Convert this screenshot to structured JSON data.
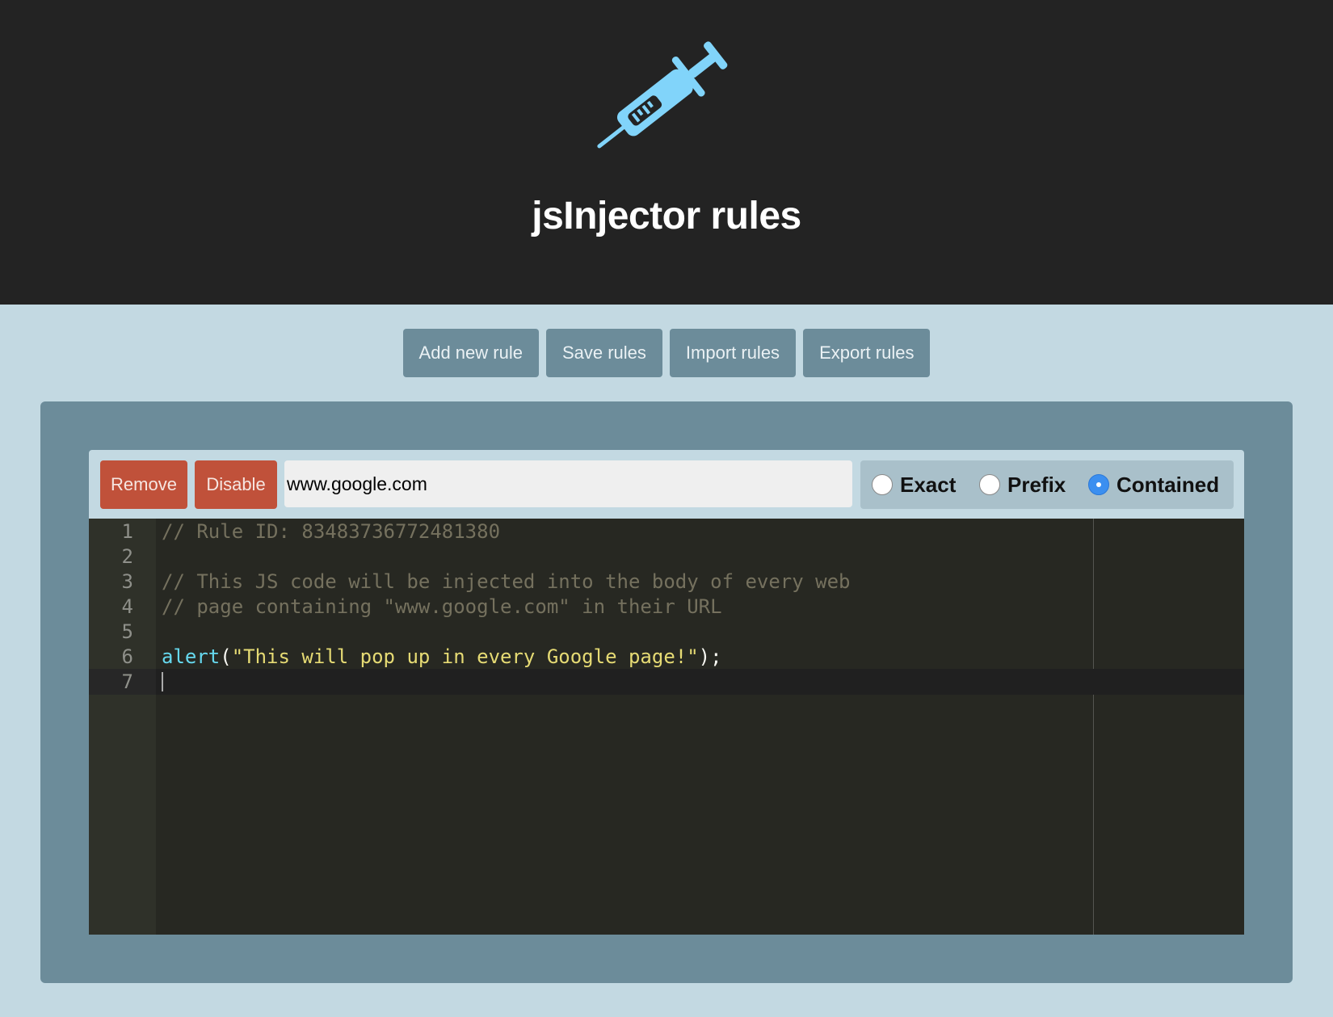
{
  "header": {
    "title": "jsInjector rules",
    "logo_icon": "syringe-icon",
    "logo_color": "#81d4fa"
  },
  "toolbar": {
    "add_label": "Add new rule",
    "save_label": "Save rules",
    "import_label": "Import rules",
    "export_label": "Export rules"
  },
  "rule": {
    "remove_label": "Remove",
    "disable_label": "Disable",
    "url_value": "www.google.com",
    "match": {
      "exact_label": "Exact",
      "prefix_label": "Prefix",
      "contained_label": "Contained",
      "selected": "Contained"
    },
    "editor": {
      "lines": [
        {
          "num": "1",
          "text": "// Rule ID: 83483736772481380"
        },
        {
          "num": "2",
          "text": ""
        },
        {
          "num": "3",
          "text": "// This JS code will be injected into the body of every web"
        },
        {
          "num": "4",
          "text": "// page containing \"www.google.com\" in their URL"
        },
        {
          "num": "5",
          "text": ""
        },
        {
          "num": "6",
          "fn": "alert",
          "open": "(",
          "str": "\"This will pop up in every Google page!\"",
          "close": ");"
        },
        {
          "num": "7",
          "text": ""
        }
      ],
      "active_line": "7"
    }
  },
  "colors": {
    "header_bg": "#232323",
    "page_bg": "#c3d9e2",
    "button_bg": "#6c8c9a",
    "danger_bg": "#c0513a",
    "editor_bg": "#272822"
  }
}
